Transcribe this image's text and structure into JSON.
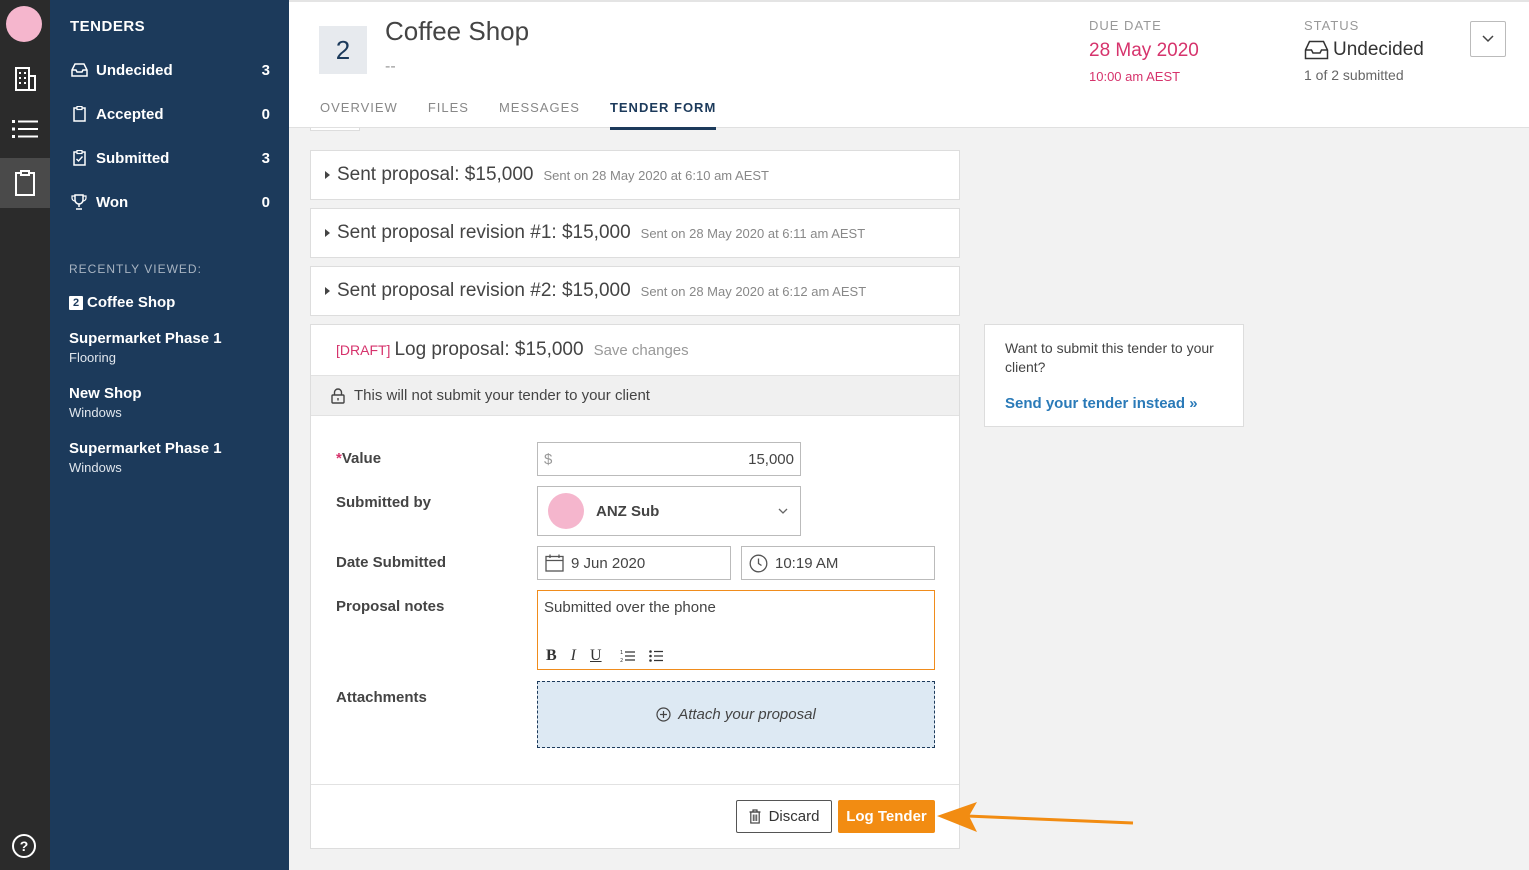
{
  "sidebar": {
    "title": "TENDERS",
    "items": [
      {
        "label": "Undecided",
        "count": "3"
      },
      {
        "label": "Accepted",
        "count": "0"
      },
      {
        "label": "Submitted",
        "count": "3"
      },
      {
        "label": "Won",
        "count": "0"
      }
    ],
    "recent_heading": "RECENTLY VIEWED:",
    "recent": [
      {
        "badge": "2",
        "title": "Coffee Shop",
        "subtitle": ""
      },
      {
        "title": "Supermarket Phase 1",
        "subtitle": "Flooring"
      },
      {
        "title": "New Shop",
        "subtitle": "Windows"
      },
      {
        "title": "Supermarket Phase 1",
        "subtitle": "Windows"
      }
    ]
  },
  "rail": {
    "help": "?"
  },
  "header": {
    "number": "2",
    "title": "Coffee Shop",
    "subtitle": "--",
    "due_label": "DUE DATE",
    "due_date": "28 May 2020",
    "due_time": "10:00 am AEST",
    "status_label": "STATUS",
    "status_value": "Undecided",
    "status_sub": "1 of 2 submitted",
    "tabs": [
      "OVERVIEW",
      "FILES",
      "MESSAGES",
      "TENDER FORM"
    ],
    "active_tab": "TENDER FORM"
  },
  "proposals": [
    {
      "title": "Sent proposal: $15,000",
      "meta": "Sent on 28 May 2020 at 6:10 am AEST"
    },
    {
      "title": "Sent proposal revision #1: $15,000",
      "meta": "Sent on 28 May 2020 at 6:11 am AEST"
    },
    {
      "title": "Sent proposal revision #2: $15,000",
      "meta": "Sent on 28 May 2020 at 6:12 am AEST"
    }
  ],
  "form": {
    "draft_tag": "[DRAFT]",
    "title": "Log proposal: $15,000",
    "save_changes": "Save changes",
    "notice": "This will not submit your tender to your client",
    "value_label": "Value",
    "required_mark": "*",
    "currency": "$",
    "value": "15,000",
    "submitted_by_label": "Submitted by",
    "submitted_by": "ANZ Sub",
    "date_label": "Date Submitted",
    "date": "9 Jun 2020",
    "time": "10:19 AM",
    "notes_label": "Proposal notes",
    "notes": "Submitted over the phone",
    "toolbar": {
      "bold": "B",
      "italic": "I",
      "underline": "U"
    },
    "attachments_label": "Attachments",
    "attach_text": "Attach your proposal",
    "discard": "Discard",
    "log": "Log Tender"
  },
  "side_card": {
    "question": "Want to submit this tender to your client?",
    "link": "Send your tender instead »"
  },
  "colors": {
    "sidebar": "#1c3a5b",
    "rail": "#2b2b2b",
    "accent_orange": "#f28c12",
    "due_pink": "#d6336c",
    "link_blue": "#2a7ab8"
  }
}
